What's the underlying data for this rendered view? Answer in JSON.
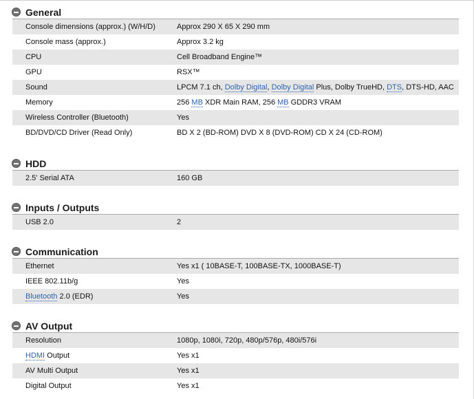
{
  "sections": [
    {
      "title": "General",
      "rows": [
        {
          "label": "Console dimensions (approx.) (W/H/D)",
          "value": "Approx 290 X 65 X 290 mm"
        },
        {
          "label": "Console mass (approx.)",
          "value": "Approx 3.2 kg"
        },
        {
          "label": "CPU",
          "value": "Cell Broadband Engine™"
        },
        {
          "label": "GPU",
          "value": "RSX™"
        },
        {
          "label": "Sound",
          "value_parts": [
            "LPCM 7.1 ch, ",
            "Dolby Digital",
            ", ",
            "Dolby Digital",
            " Plus, Dolby TrueHD, ",
            "DTS",
            ", DTS-HD, AAC"
          ]
        },
        {
          "label": "Memory",
          "value_parts": [
            "256 ",
            "MB",
            " XDR Main RAM, 256 ",
            "MB",
            " GDDR3 VRAM"
          ]
        },
        {
          "label": "Wireless Controller (Bluetooth)",
          "value": "Yes"
        },
        {
          "label": "BD/DVD/CD Driver (Read Only)",
          "value": "BD X 2 (BD-ROM) DVD X 8 (DVD-ROM) CD X 24 (CD-ROM)"
        }
      ]
    },
    {
      "title": "HDD",
      "rows": [
        {
          "label": "2.5' Serial ATA",
          "value": "160 GB"
        }
      ]
    },
    {
      "title": "Inputs / Outputs",
      "rows": [
        {
          "label": "USB 2.0",
          "value": "2"
        }
      ]
    },
    {
      "title": "Communication",
      "rows": [
        {
          "label": "Ethernet",
          "value": "Yes x1 ( 10BASE-T, 100BASE-TX, 1000BASE-T)"
        },
        {
          "label": "IEEE 802.11b/g",
          "value": "Yes"
        },
        {
          "label_parts": [
            "Bluetooth",
            " 2.0 (EDR)"
          ],
          "value": "Yes"
        }
      ]
    },
    {
      "title": "AV Output",
      "rows": [
        {
          "label": "Resolution",
          "value": "1080p, 1080i, 720p, 480p/576p, 480i/576i"
        },
        {
          "label_parts": [
            "HDMI",
            " Output"
          ],
          "value": "Yes x1"
        },
        {
          "label": "AV Multi Output",
          "value": "Yes x1"
        },
        {
          "label": "Digital Output",
          "value": "Yes x1"
        }
      ]
    }
  ]
}
